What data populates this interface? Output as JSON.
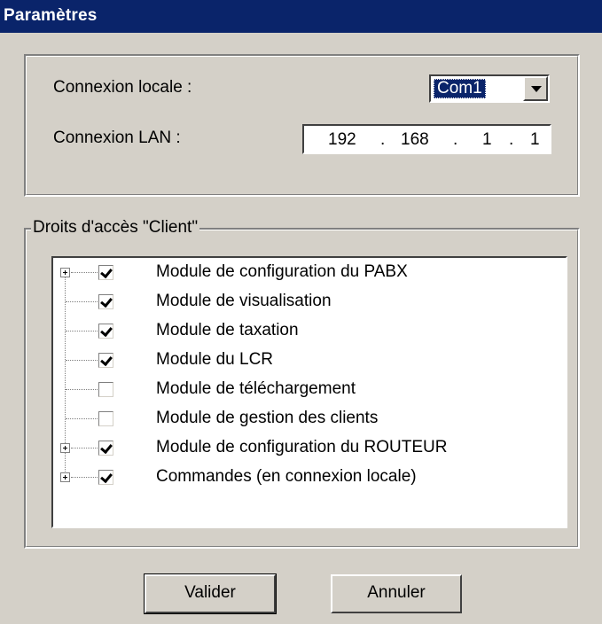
{
  "window": {
    "title": "Paramètres"
  },
  "connection": {
    "local_label": "Connexion locale :",
    "local_value": "Com1",
    "lan_label": "Connexion LAN :",
    "ip": [
      "192",
      "168",
      "1",
      "1"
    ],
    "ip_separator": "."
  },
  "rights": {
    "legend": "Droits d'accès \"Client\"",
    "items": [
      {
        "label": "Module de configuration du PABX",
        "checked": true,
        "expandable": true
      },
      {
        "label": "Module de visualisation",
        "checked": true,
        "expandable": false
      },
      {
        "label": "Module de taxation",
        "checked": true,
        "expandable": false
      },
      {
        "label": "Module du LCR",
        "checked": true,
        "expandable": false
      },
      {
        "label": "Module de téléchargement",
        "checked": false,
        "expandable": false
      },
      {
        "label": "Module de gestion des clients",
        "checked": false,
        "expandable": false
      },
      {
        "label": "Module de configuration du ROUTEUR",
        "checked": true,
        "expandable": true
      },
      {
        "label": "Commandes (en connexion locale)",
        "checked": true,
        "expandable": true
      }
    ]
  },
  "buttons": {
    "ok_label": "Valider",
    "cancel_label": "Annuler"
  },
  "colors": {
    "titlebar": "#0a246a",
    "face": "#d4d0c8",
    "selection": "#0a246a"
  }
}
